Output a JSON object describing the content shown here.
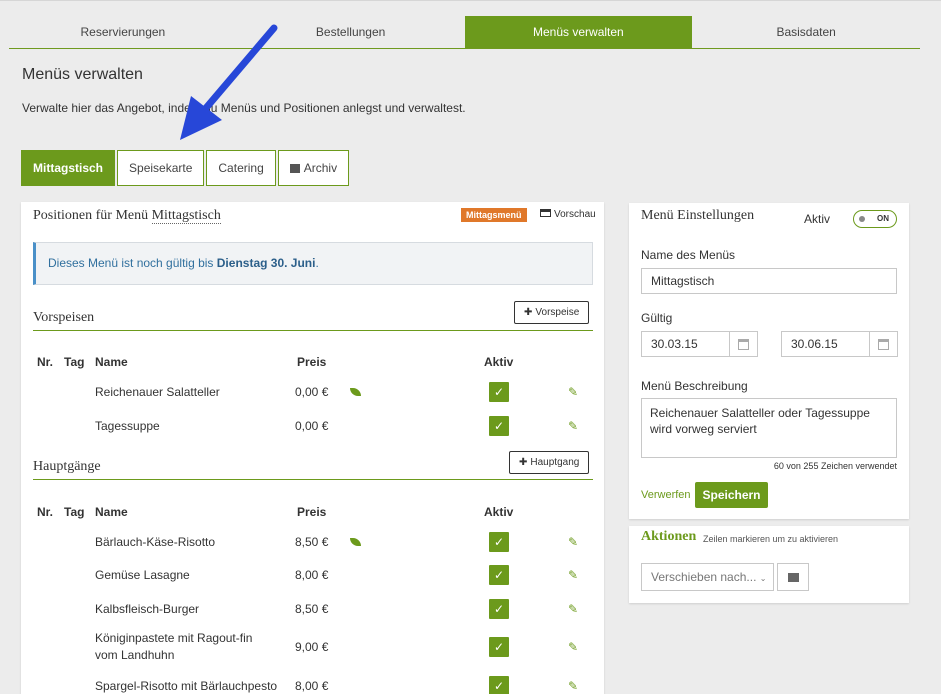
{
  "topnav": {
    "tabs": [
      {
        "label": "Reservierungen"
      },
      {
        "label": "Bestellungen"
      },
      {
        "label": "Menüs verwalten"
      },
      {
        "label": "Basisdaten"
      }
    ]
  },
  "page": {
    "title": "Menüs verwalten",
    "description": "Verwalte hier das Angebot, indem du Menüs und Positionen anlegst und verwaltest."
  },
  "subtabs": [
    {
      "label": "Mittagstisch"
    },
    {
      "label": "Speisekarte"
    },
    {
      "label": "Catering"
    },
    {
      "label": "Archiv"
    }
  ],
  "positions": {
    "heading_prefix": "Positionen für Menü",
    "menu_name": "Mittagstisch",
    "badge": "Mittagsmenü",
    "preview_label": "Vorschau",
    "info_prefix": "Dieses Menü ist noch gültig bis",
    "info_date": "Dienstag 30. Juni",
    "info_suffix": "."
  },
  "table_headers": {
    "nr": "Nr.",
    "tag": "Tag",
    "name": "Name",
    "preis": "Preis",
    "aktiv": "Aktiv"
  },
  "sections": [
    {
      "title": "Vorspeisen",
      "add_label": "Vorspeise",
      "rows": [
        {
          "name": "Reichenauer Salatteller",
          "price": "0,00 €",
          "veg": true,
          "active": true
        },
        {
          "name": "Tagessuppe",
          "price": "0,00 €",
          "veg": false,
          "active": true
        }
      ]
    },
    {
      "title": "Hauptgänge",
      "add_label": "Hauptgang",
      "rows": [
        {
          "name": "Bärlauch-Käse-Risotto",
          "price": "8,50 €",
          "veg": true,
          "active": true
        },
        {
          "name": "Gemüse Lasagne",
          "price": "8,00 €",
          "veg": false,
          "active": true
        },
        {
          "name": "Kalbsfleisch-Burger",
          "price": "8,50 €",
          "veg": false,
          "active": true
        },
        {
          "name": "Königinpastete mit Ragout-fin",
          "name2": "vom Landhuhn",
          "price": "9,00 €",
          "veg": false,
          "active": true
        },
        {
          "name": "Spargel-Risotto mit Bärlauchpesto",
          "price": "8,00 €",
          "veg": false,
          "active": true
        }
      ]
    }
  ],
  "settings": {
    "title": "Menü Einstellungen",
    "aktiv_label": "Aktiv",
    "toggle_label": "ON",
    "name_label": "Name des Menüs",
    "name_value": "Mittagstisch",
    "valid_label": "Gültig",
    "valid_from": "30.03.15",
    "valid_to": "30.06.15",
    "desc_label": "Menü Beschreibung",
    "desc_value": "Reichenauer Salatteller oder Tagessuppe wird vorweg serviert",
    "counter": "60 von 255 Zeichen verwendet",
    "discard_label": "Verwerfen",
    "save_label": "Speichern"
  },
  "actions": {
    "title": "Aktionen",
    "hint": "Zeilen markieren um zu aktivieren",
    "move_placeholder": "Verschieben nach..."
  },
  "colors": {
    "accent": "#6c9a1c",
    "badge": "#e0782a",
    "info": "#4a90c8",
    "arrow": "#2747d8"
  },
  "icons": [
    "plus-icon",
    "check-icon",
    "pencil-icon",
    "leaf-icon",
    "calendar-icon",
    "archive-icon",
    "preview-icon",
    "chevron-down-icon",
    "arrow-annotation"
  ]
}
